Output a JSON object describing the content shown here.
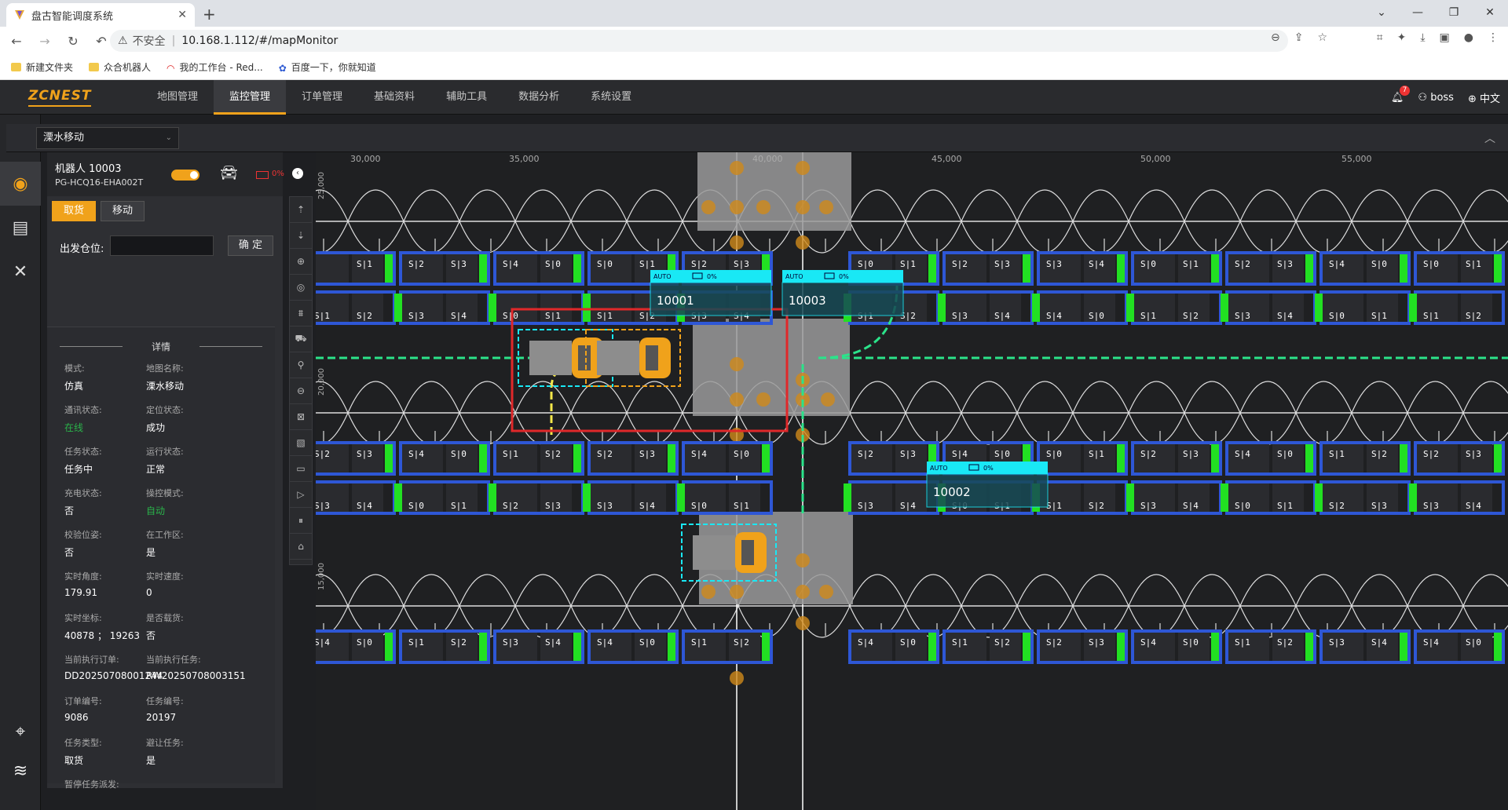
{
  "browser": {
    "tab_title": "盘古智能调度系统",
    "url_warning": "不安全",
    "url": "10.168.1.112/#/mapMonitor",
    "bookmarks": [
      "新建文件夹",
      "众合机器人",
      "我的工作台 - Red...",
      "百度一下，你就知道"
    ]
  },
  "app": {
    "logo": "ZCNEST",
    "menu": [
      "地图管理",
      "监控管理",
      "订单管理",
      "基础资料",
      "辅助工具",
      "数据分析",
      "系统设置"
    ],
    "active_menu": "监控管理",
    "notification_count": "7",
    "user": "boss",
    "language": "中文"
  },
  "map_selector": {
    "value": "溧水移动"
  },
  "robot_panel": {
    "title": "机器人  10003",
    "id": "PG-HCQ16-EHA002T",
    "battery": "0%",
    "btn_pickup": "取货",
    "btn_move": "移动",
    "origin_label": "出发仓位:",
    "origin_value": "",
    "confirm": "确 定",
    "details_title": "详情",
    "details": [
      {
        "k": "模式:",
        "v": "仿真"
      },
      {
        "k": "地图名称:",
        "v": "溧水移动"
      },
      {
        "k": "通讯状态:",
        "v": "在线"
      },
      {
        "k": "定位状态:",
        "v": "成功"
      },
      {
        "k": "任务状态:",
        "v": "任务中"
      },
      {
        "k": "运行状态:",
        "v": "正常"
      },
      {
        "k": "充电状态:",
        "v": "否"
      },
      {
        "k": "操控模式:",
        "v": "自动"
      },
      {
        "k": "校验位姿:",
        "v": "否"
      },
      {
        "k": "在工作区:",
        "v": "是"
      },
      {
        "k": "实时角度:",
        "v": "179.91"
      },
      {
        "k": "实时速度:",
        "v": "0"
      },
      {
        "k": "实时坐标:",
        "v": "40878  ；  19263"
      },
      {
        "k": "是否载货:",
        "v": "否"
      },
      {
        "k": "当前执行订单:",
        "v": "DD20250708001244"
      },
      {
        "k": "当前执行任务:",
        "v": "RW20250708003151"
      },
      {
        "k": "订单编号:",
        "v": "9086"
      },
      {
        "k": "任务编号:",
        "v": "20197"
      },
      {
        "k": "任务类型:",
        "v": "取货"
      },
      {
        "k": "避让任务:",
        "v": "是"
      },
      {
        "k": "暂停任务派发:",
        "v": ""
      }
    ]
  },
  "map": {
    "x_ticks": [
      "30,000",
      "35,000",
      "40,000",
      "45,000",
      "50,000",
      "55,000"
    ],
    "y_ticks": [
      "25,000",
      "20,000",
      "15,000"
    ],
    "robots": [
      {
        "label": "10001",
        "mode": "AUTO",
        "battery": "0%"
      },
      {
        "label": "10003",
        "mode": "AUTO",
        "battery": "0%"
      },
      {
        "label": "10002",
        "mode": "AUTO",
        "battery": "0%"
      }
    ],
    "slot_labels": [
      "S|1",
      "S|2",
      "S|3",
      "S|4",
      "S|0"
    ],
    "colors": {
      "rack": "#2e57d6",
      "charger": "#22e022",
      "path": "#ffffff",
      "route": "#2be38a",
      "accent": "#f0a21b",
      "alert": "#e0282a",
      "cyan": "#19e8f5"
    }
  }
}
